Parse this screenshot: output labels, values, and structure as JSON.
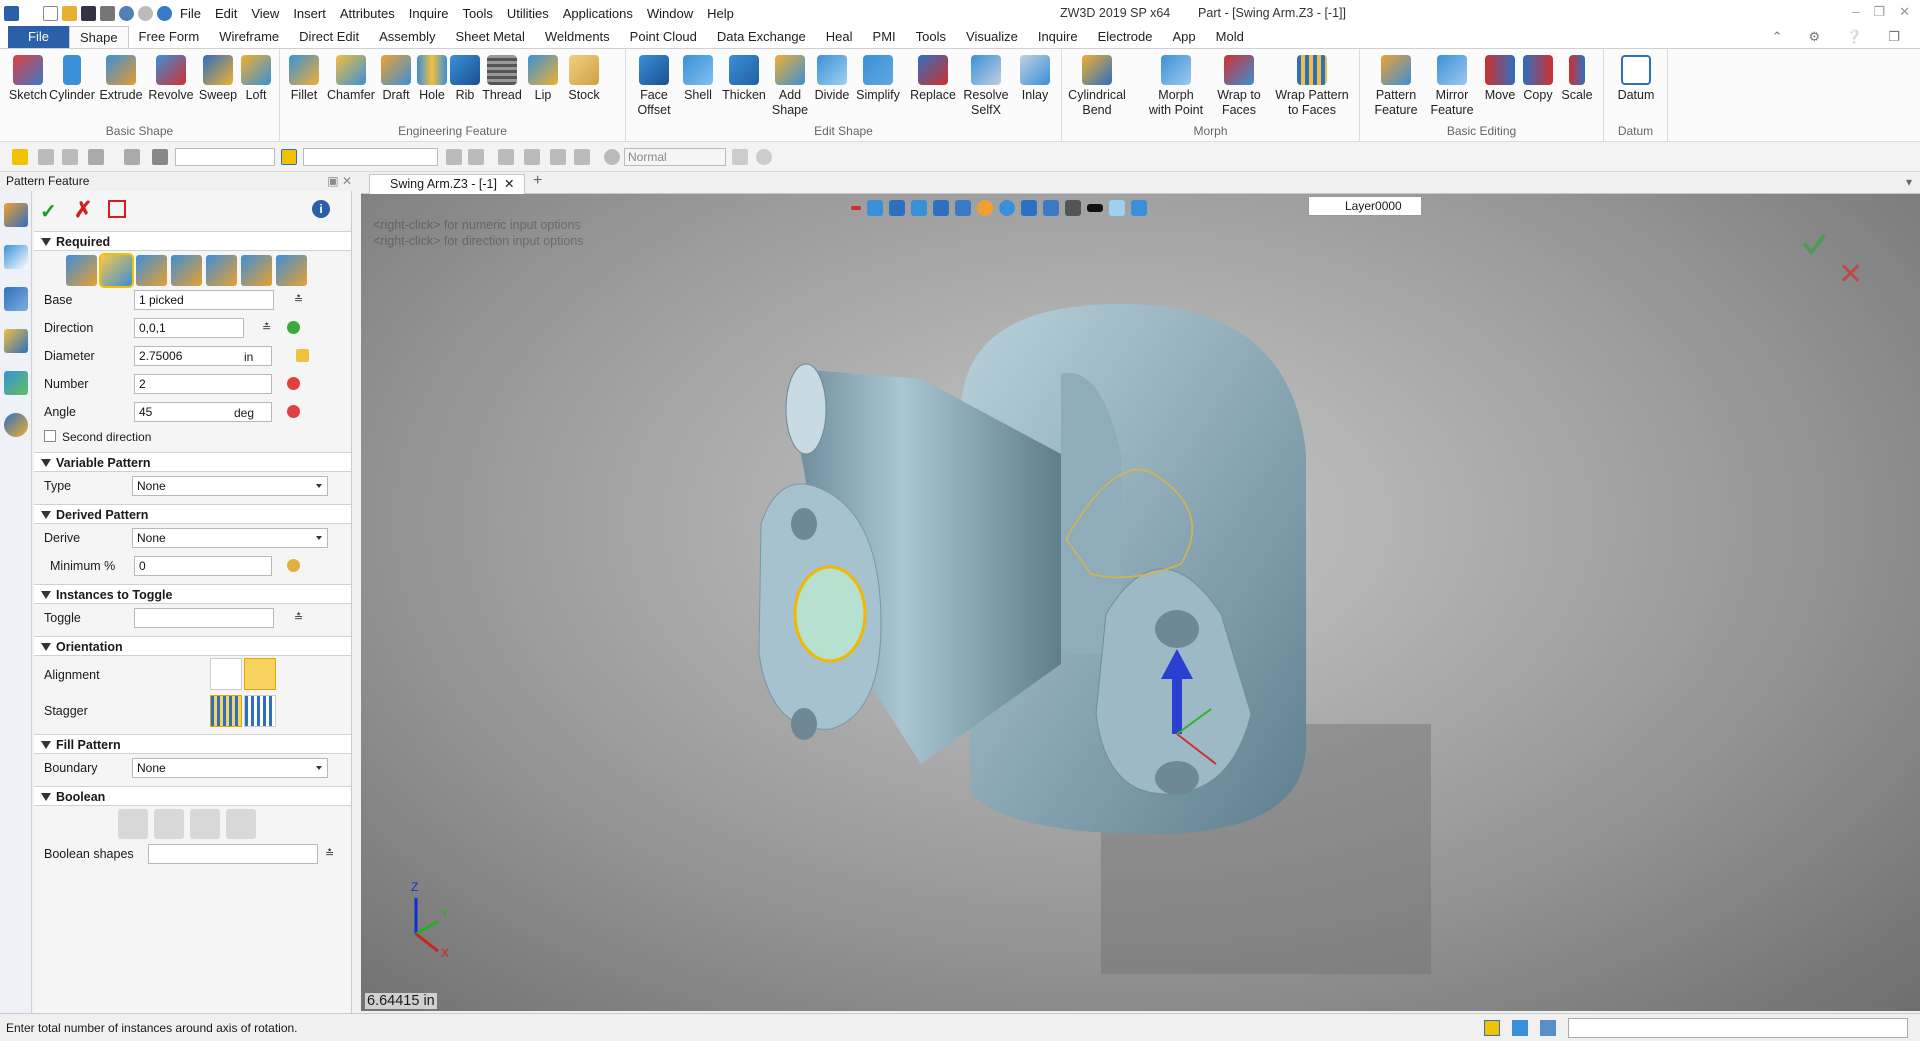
{
  "window": {
    "title": "ZW3D 2019 SP x64",
    "document": "Part - [Swing Arm.Z3 - [-1]]"
  },
  "menu": [
    "File",
    "Edit",
    "View",
    "Insert",
    "Attributes",
    "Inquire",
    "Tools",
    "Utilities",
    "Applications",
    "Window",
    "Help"
  ],
  "ribbon_tabs": [
    "File",
    "Shape",
    "Free Form",
    "Wireframe",
    "Direct Edit",
    "Assembly",
    "Sheet Metal",
    "Weldments",
    "Point Cloud",
    "Data Exchange",
    "Heal",
    "PMI",
    "Tools",
    "Visualize",
    "Inquire",
    "Electrode",
    "App",
    "Mold"
  ],
  "ribbon_active": "Shape",
  "groups": [
    {
      "label": "Basic Shape",
      "buttons": [
        "Sketch",
        "Cylinder",
        "Extrude",
        "Revolve",
        "Sweep",
        "Loft"
      ]
    },
    {
      "label": "Engineering Feature",
      "buttons": [
        "Fillet",
        "Chamfer",
        "Draft",
        "Hole",
        "Rib",
        "Thread",
        "Lip",
        "Stock"
      ]
    },
    {
      "label": "Edit Shape",
      "buttons": [
        "Face Offset",
        "Shell",
        "Thicken",
        "Add Shape",
        "Divide",
        "Simplify",
        "Replace",
        "Resolve SelfX",
        "Inlay"
      ]
    },
    {
      "label": "Morph",
      "buttons": [
        "Cylindrical Bend",
        "Morph with Point",
        "Wrap to Faces",
        "Wrap Pattern to Faces"
      ]
    },
    {
      "label": "Basic Editing",
      "buttons": [
        "Pattern Feature",
        "Mirror Feature",
        "Move",
        "Copy",
        "Scale"
      ]
    },
    {
      "label": "Datum",
      "buttons": [
        "Datum"
      ]
    }
  ],
  "toolbar": {
    "render_mode": "Normal"
  },
  "panel": {
    "title": "Pattern Feature",
    "required": {
      "label": "Required",
      "base_label": "Base",
      "base_value": "1 picked",
      "direction_label": "Direction",
      "direction_value": "0,0,1",
      "diameter_label": "Diameter",
      "diameter_value": "2.75006",
      "diameter_unit": "in",
      "number_label": "Number",
      "number_value": "2",
      "angle_label": "Angle",
      "angle_value": "45",
      "angle_unit": "deg",
      "second_direction": "Second direction"
    },
    "variable": {
      "label": "Variable Pattern",
      "type_label": "Type",
      "type_value": "None"
    },
    "derived": {
      "label": "Derived Pattern",
      "derive_label": "Derive",
      "derive_value": "None",
      "min_label": "Minimum %",
      "min_value": "0"
    },
    "toggle": {
      "label": "Instances to Toggle",
      "toggle_label": "Toggle",
      "toggle_value": ""
    },
    "orientation": {
      "label": "Orientation",
      "alignment_label": "Alignment",
      "stagger_label": "Stagger"
    },
    "fill": {
      "label": "Fill Pattern",
      "boundary_label": "Boundary",
      "boundary_value": "None"
    },
    "boolean": {
      "label": "Boolean",
      "shapes_label": "Boolean shapes",
      "shapes_value": ""
    }
  },
  "doc_tab": "Swing Arm.Z3 - [-1]",
  "viewport": {
    "hint1": "<right-click> for numeric input options",
    "hint2": "<right-click> for direction input options",
    "layer": "Layer0000",
    "measure": "6.64415 in",
    "axes": {
      "z": "Z",
      "y": "Y",
      "x": "X"
    }
  },
  "status": "Enter total number of instances around axis of rotation.",
  "colors": {
    "accent": "#2b5fa8",
    "model": "#8fb0c0",
    "highlight": "#f2b800"
  }
}
